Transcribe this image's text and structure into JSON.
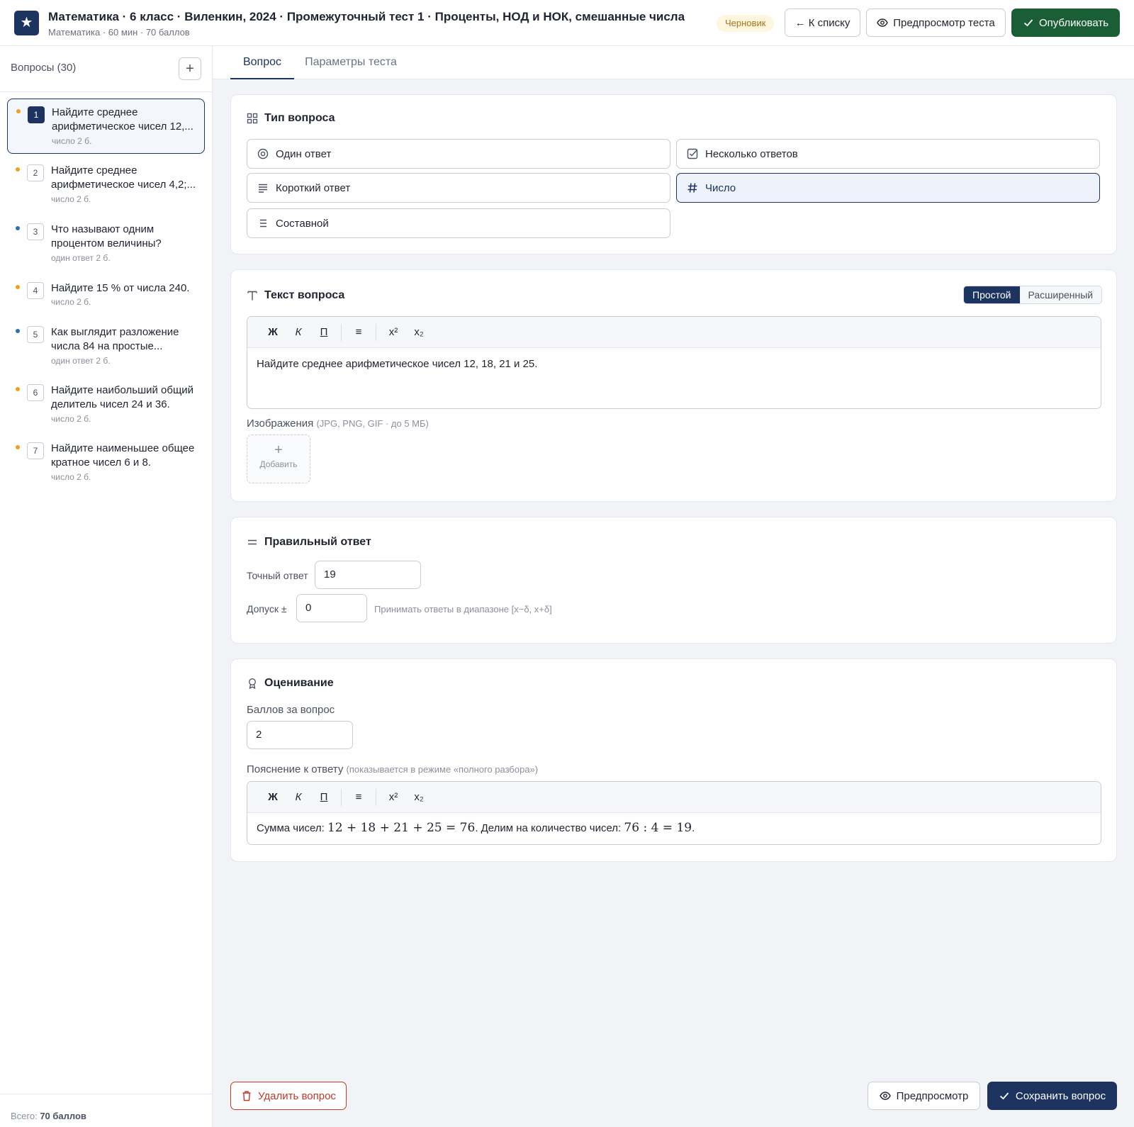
{
  "header": {
    "logo_glyph": "★",
    "title": "Математика · 6 класс · Виленкин, 2024 · Промежуточный тест 1 · Проценты, НОД и НОК, смешанные числа",
    "subtitle": "Математика · 60 мин · 70 баллов",
    "status_badge": "Черновик",
    "back_label": "← К списку",
    "preview_test_label": "Предпросмотр теста",
    "publish_label": "Опубликовать"
  },
  "sidebar": {
    "heading": "Вопросы (30)",
    "add_label": "+",
    "items": [
      {
        "num": "1",
        "text": "Найдите среднее арифметическое чисел 12,...",
        "meta": "число  2 б.",
        "dot": "#f0a020"
      },
      {
        "num": "2",
        "text": "Найдите среднее арифметическое чисел 4,2;...",
        "meta": "число  2 б.",
        "dot": "#f0a020"
      },
      {
        "num": "3",
        "text": "Что называют одним процентом величины?",
        "meta": "один ответ  2 б.",
        "dot": "#2f6fb5"
      },
      {
        "num": "4",
        "text": "Найдите 15 % от числа 240.",
        "meta": "число  2 б.",
        "dot": "#f0a020"
      },
      {
        "num": "5",
        "text": "Как выглядит разложение числа 84 на простые...",
        "meta": "один ответ  2 б.",
        "dot": "#2f6fb5"
      },
      {
        "num": "6",
        "text": "Найдите наибольший общий делитель чисел 24 и 36.",
        "meta": "число  2 б.",
        "dot": "#f0a020"
      },
      {
        "num": "7",
        "text": "Найдите наименьшее общее кратное чисел 6 и 8.",
        "meta": "число  2 б.",
        "dot": "#f0a020"
      }
    ],
    "total_prefix": "Всего: ",
    "total_value": "70 баллов"
  },
  "tabs": {
    "question": "Вопрос",
    "params": "Параметры теста"
  },
  "question_type": {
    "title": "Тип вопроса",
    "options": {
      "single": "Один ответ",
      "multiple": "Несколько ответов",
      "short": "Короткий ответ",
      "number": "Число",
      "composite": "Составной"
    },
    "selected": "number"
  },
  "question_text": {
    "title": "Текст вопроса",
    "mode_simple": "Простой",
    "mode_extended": "Расширенный",
    "toolbar": {
      "bold": "Ж",
      "italic": "К",
      "underline": "П",
      "list": "≡",
      "sup": "x²",
      "sub": "x₂"
    },
    "content": "Найдите среднее арифметическое чисел 12, 18, 21 и 25.",
    "images_label": "Изображения",
    "images_hint": "(JPG, PNG, GIF · до 5 МБ)",
    "add_image": "Добавить"
  },
  "correct_answer": {
    "title": "Правильный ответ",
    "exact_label": "Точный ответ",
    "exact_value": "19",
    "tolerance_label": "Допуск ±",
    "tolerance_value": "0",
    "tolerance_hint": "Принимать ответы в диапазоне [x−δ, x+δ]"
  },
  "grading": {
    "title": "Оценивание",
    "points_label": "Баллов за вопрос",
    "points_value": "2",
    "explanation_label": "Пояснение к ответу",
    "explanation_hint": "(показывается в режиме «полного разбора»)",
    "explanation_part1": "Сумма чисел: ",
    "explanation_math1": "12 + 18 + 21 + 25 = 76",
    "explanation_part2": ". Делим на количество чисел: ",
    "explanation_math2": "76 : 4 = 19",
    "explanation_part3": "."
  },
  "footer": {
    "delete_label": "Удалить вопрос",
    "preview_label": "Предпросмотр",
    "save_label": "Сохранить вопрос"
  },
  "colors": {
    "brand": "#1d3461",
    "publish": "#1a5e35",
    "danger": "#c0392b",
    "dot_number": "#f0a020",
    "dot_choice": "#2f6fb5"
  }
}
